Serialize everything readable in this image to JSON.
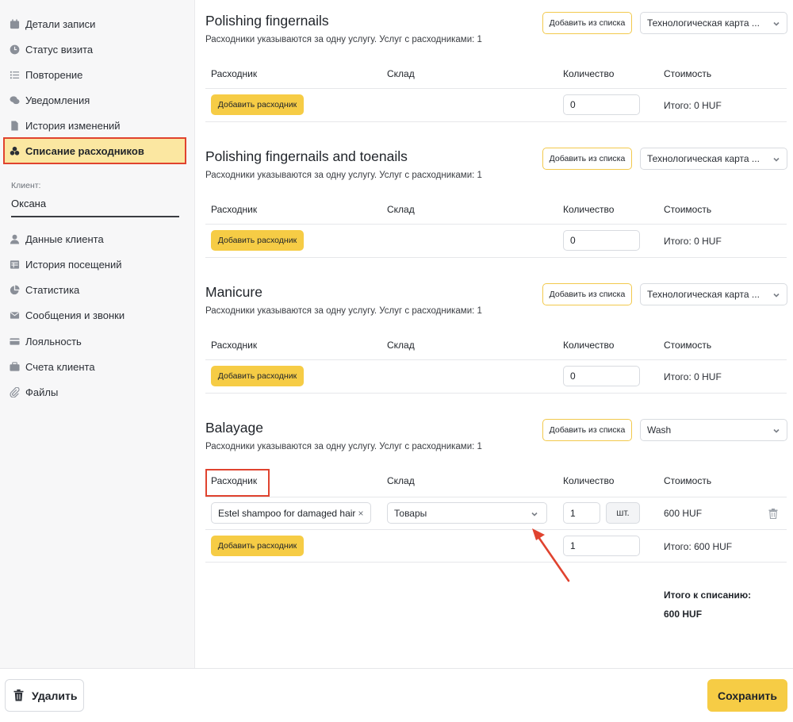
{
  "sidebar": {
    "nav_top": [
      {
        "label": "Детали записи",
        "icon": "calendar-icon"
      },
      {
        "label": "Статус визита",
        "icon": "clock-icon"
      },
      {
        "label": "Повторение",
        "icon": "list-icon"
      },
      {
        "label": "Уведомления",
        "icon": "chat-icon"
      },
      {
        "label": "История изменений",
        "icon": "document-icon"
      },
      {
        "label": "Списание расходников",
        "icon": "cubes-icon",
        "active": true
      }
    ],
    "client_label": "Клиент:",
    "client_name": "Оксана",
    "nav_bottom": [
      {
        "label": "Данные клиента",
        "icon": "user-icon"
      },
      {
        "label": "История посещений",
        "icon": "table-icon"
      },
      {
        "label": "Статистика",
        "icon": "pie-chart-icon"
      },
      {
        "label": "Сообщения и звонки",
        "icon": "envelope-icon"
      },
      {
        "label": "Лояльность",
        "icon": "card-icon"
      },
      {
        "label": "Счета клиента",
        "icon": "wallet-icon"
      },
      {
        "label": "Файлы",
        "icon": "paperclip-icon"
      }
    ]
  },
  "columns": {
    "item": "Расходник",
    "warehouse": "Склад",
    "quantity": "Количество",
    "cost": "Стоимость"
  },
  "add_from_list_label": "Добавить из списка",
  "add_item_label": "Добавить расходник",
  "services": [
    {
      "title": "Polishing fingernails",
      "subtitle": "Расходники указываются за одну услугу. Услуг с расходниками: 1",
      "tech_card": "Технологическая карта ...",
      "qty": "0",
      "total": "Итого: 0 HUF"
    },
    {
      "title": "Polishing fingernails and toenails",
      "subtitle": "Расходники указываются за одну услугу. Услуг с расходниками: 1",
      "tech_card": "Технологическая карта ...",
      "qty": "0",
      "total": "Итого: 0 HUF"
    },
    {
      "title": "Manicure",
      "subtitle": "Расходники указываются за одну услугу. Услуг с расходниками: 1",
      "tech_card": "Технологическая карта ...",
      "qty": "0",
      "total": "Итого: 0 HUF"
    },
    {
      "title": "Balayage",
      "subtitle": "Расходники указываются за одну услугу. Услуг с расходниками: 1",
      "tech_card": "Wash",
      "row": {
        "item": "Estel shampoo for damaged hair",
        "warehouse": "Товары",
        "qty": "1",
        "unit": "шт.",
        "cost": "600 HUF"
      },
      "qty": "1",
      "total": "Итого: 600 HUF"
    }
  ],
  "grand_total_label": "Итого к списанию:",
  "grand_total_value": "600 HUF",
  "footer": {
    "delete_label": "Удалить",
    "save_label": "Сохранить"
  },
  "colors": {
    "accent": "#f6cc45",
    "highlight_border": "#e0432f",
    "active_bg": "#fbe7a1"
  }
}
